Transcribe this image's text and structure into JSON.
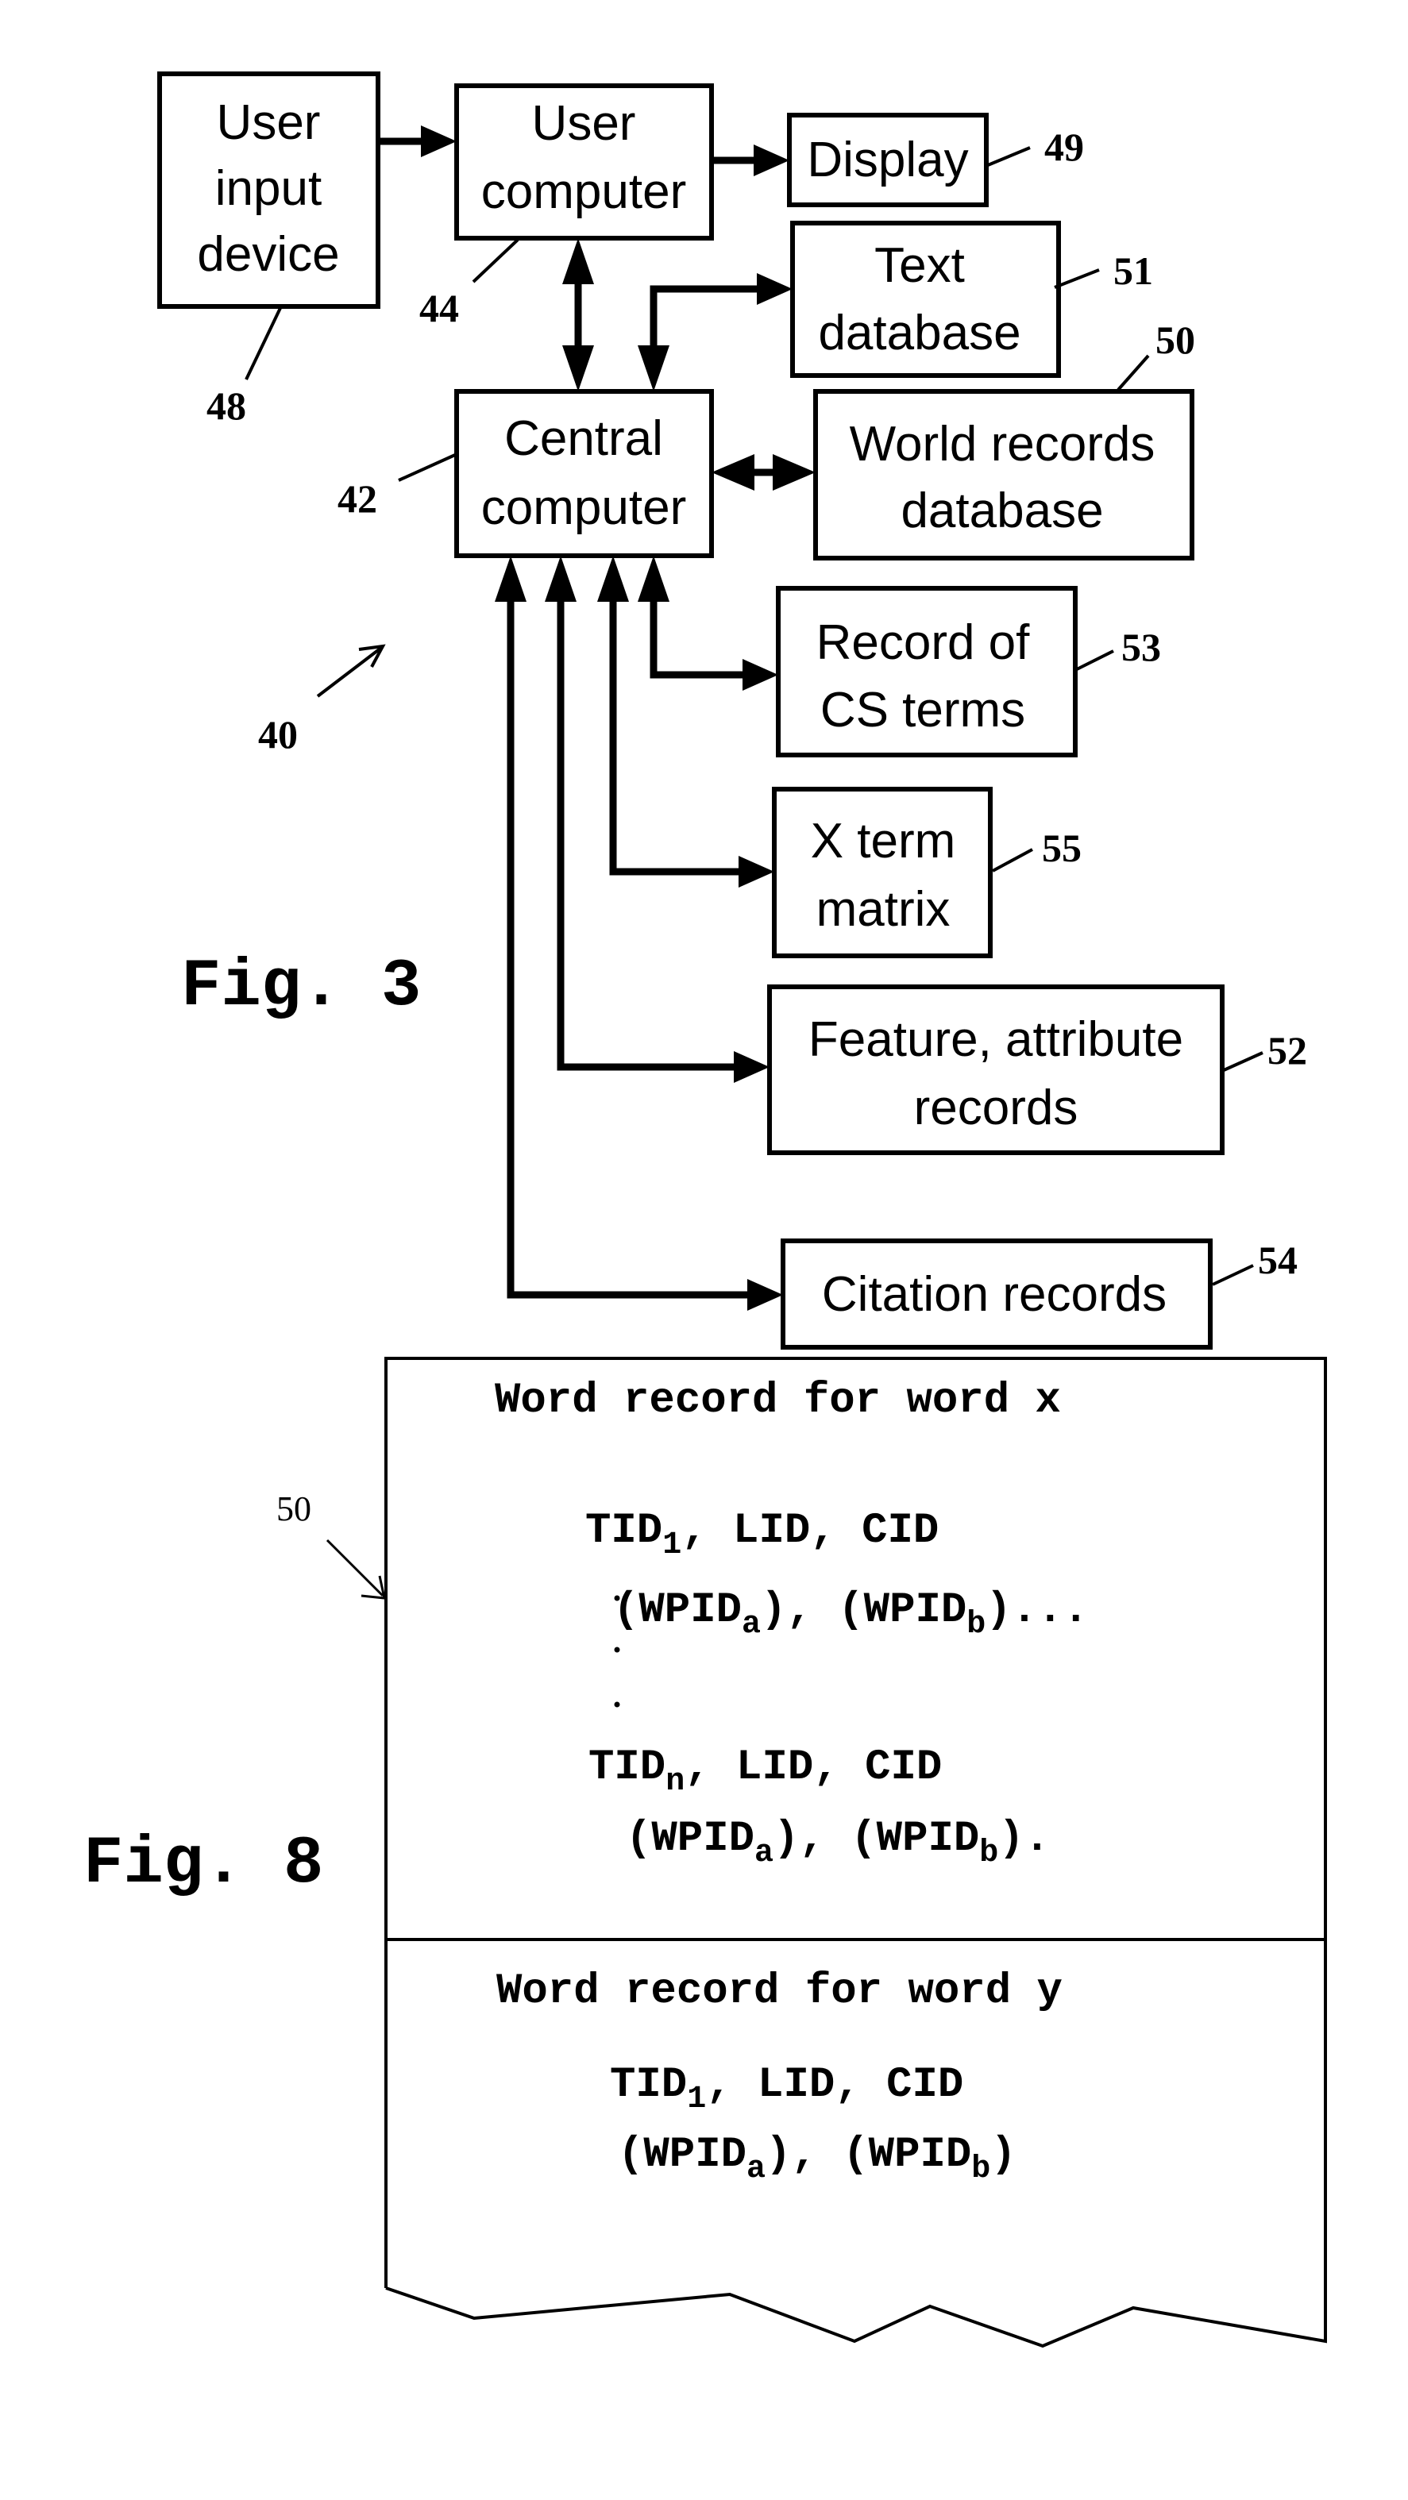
{
  "fig3": {
    "caption": "Fig. 3",
    "system_ref": "40",
    "boxes": [
      {
        "id": "user-input-device",
        "lines": [
          "User",
          "input",
          "device"
        ],
        "ref": "48"
      },
      {
        "id": "user-computer",
        "lines": [
          "User",
          "computer"
        ],
        "ref": "44"
      },
      {
        "id": "display",
        "lines": [
          "Display"
        ],
        "ref": "49"
      },
      {
        "id": "text-database",
        "lines": [
          "Text",
          "database"
        ],
        "ref": "51"
      },
      {
        "id": "world-records-database",
        "lines": [
          "World records",
          "database"
        ],
        "ref": "50"
      },
      {
        "id": "central-computer",
        "lines": [
          "Central",
          "computer"
        ],
        "ref": "42"
      },
      {
        "id": "record-of-cs-terms",
        "lines": [
          "Record of",
          "CS terms"
        ],
        "ref": "53"
      },
      {
        "id": "x-term-matrix",
        "lines": [
          "X term",
          "matrix"
        ],
        "ref": "55"
      },
      {
        "id": "feature-attribute-records",
        "lines": [
          "Feature, attribute",
          "records"
        ],
        "ref": "52"
      },
      {
        "id": "citation-records",
        "lines": [
          "Citation records"
        ],
        "ref": "54"
      }
    ],
    "connections": [
      {
        "from": "user-input-device",
        "to": "user-computer",
        "direction": "one-way"
      },
      {
        "from": "user-computer",
        "to": "display",
        "direction": "one-way"
      },
      {
        "from": "user-computer",
        "to": "central-computer",
        "direction": "two-way"
      },
      {
        "from": "central-computer",
        "to": "text-database",
        "direction": "two-way"
      },
      {
        "from": "central-computer",
        "to": "world-records-database",
        "direction": "two-way"
      },
      {
        "from": "central-computer",
        "to": "record-of-cs-terms",
        "direction": "two-way"
      },
      {
        "from": "central-computer",
        "to": "x-term-matrix",
        "direction": "two-way"
      },
      {
        "from": "central-computer",
        "to": "feature-attribute-records",
        "direction": "two-way"
      },
      {
        "from": "central-computer",
        "to": "citation-records",
        "direction": "two-way"
      }
    ]
  },
  "fig8": {
    "caption": "Fig. 8",
    "ref": "50",
    "records": [
      {
        "title": "Word record for word x",
        "lines": [
          {
            "main": "TID",
            "sub": "1",
            "rest": ", LID, CID"
          },
          {
            "parts": [
              {
                "t": "(WPID"
              },
              {
                "s": "a"
              },
              {
                "t": "), (WPID"
              },
              {
                "s": "b"
              },
              {
                "t": ")..."
              }
            ]
          },
          {
            "main": "TID",
            "sub": "n",
            "rest": ", LID, CID"
          },
          {
            "parts": [
              {
                "t": "(WPID"
              },
              {
                "s": "a"
              },
              {
                "t": "), (WPID"
              },
              {
                "s": "b"
              },
              {
                "t": ")."
              }
            ]
          }
        ]
      },
      {
        "title": "Word record for word y",
        "lines": [
          {
            "main": "TID",
            "sub": "1",
            "rest": ", LID, CID"
          },
          {
            "parts": [
              {
                "t": "(WPID"
              },
              {
                "s": "a"
              },
              {
                "t": "), (WPID"
              },
              {
                "s": "b"
              },
              {
                "t": ")"
              }
            ]
          }
        ]
      }
    ]
  }
}
